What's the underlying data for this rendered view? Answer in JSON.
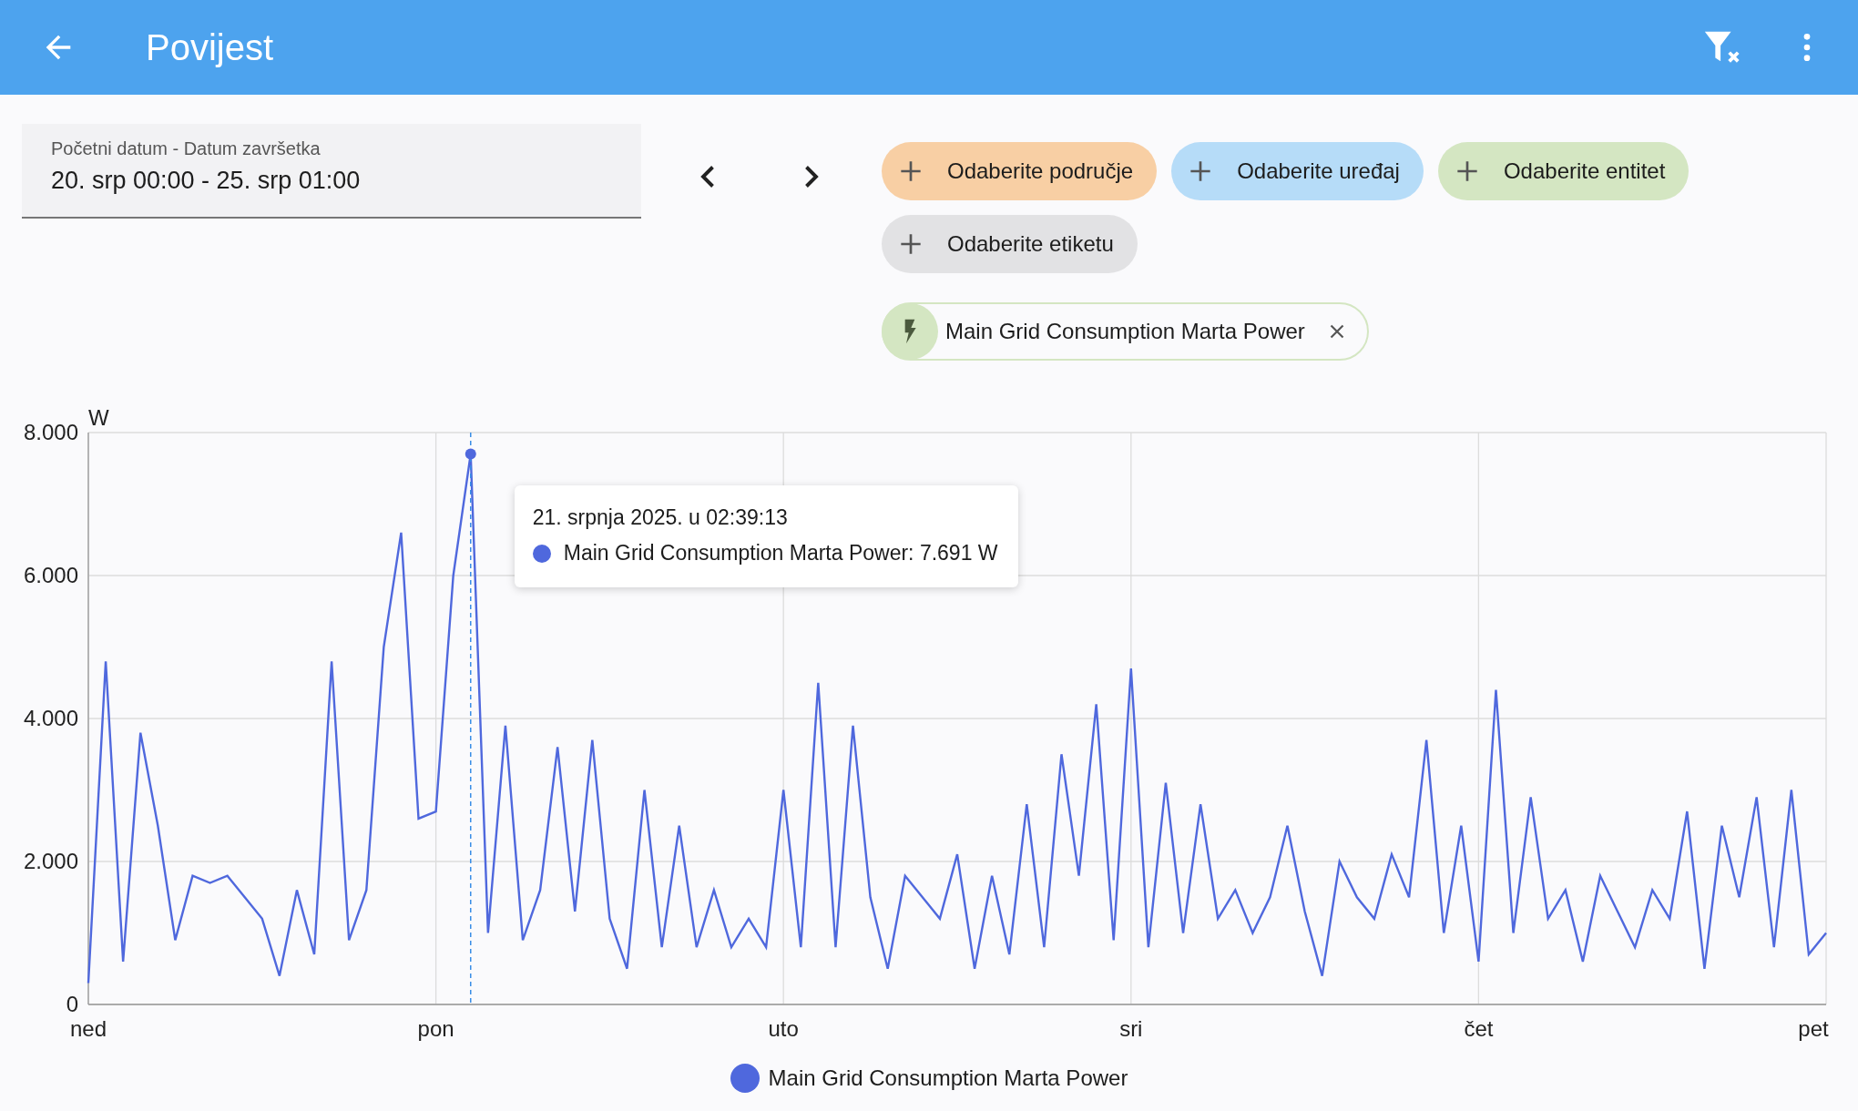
{
  "top_bar": {
    "title": "Povijest"
  },
  "date_range": {
    "label": "Početni datum - Datum završetka",
    "value": "20. srp 00:00 - 25. srp 01:00"
  },
  "target_chips": [
    {
      "label": "Odaberite područje",
      "color": "#f8cfa4"
    },
    {
      "label": "Odaberite uređaj",
      "color": "#b6dcf8"
    },
    {
      "label": "Odaberite entitet",
      "color": "#d4e6c2"
    },
    {
      "label": "Odaberite etiketu",
      "color": "#e2e2e4"
    }
  ],
  "selected_entities": [
    {
      "label": "Main Grid Consumption Marta Power",
      "color": "#d4e6c2"
    }
  ],
  "history": {
    "chart_data": {
      "type": "line",
      "grid": true,
      "ylabel": "W",
      "ylim": [
        0,
        8000
      ],
      "yticks": [
        {
          "value": 0,
          "label": "0"
        },
        {
          "value": 2000,
          "label": "2.000"
        },
        {
          "value": 4000,
          "label": "4.000"
        },
        {
          "value": 6000,
          "label": "6.000"
        },
        {
          "value": 8000,
          "label": "8.000"
        }
      ],
      "categories": [
        "ned",
        null,
        null,
        null,
        null,
        null,
        null,
        null,
        null,
        null,
        null,
        null,
        null,
        null,
        null,
        null,
        null,
        null,
        null,
        null,
        "pon",
        null,
        null,
        null,
        null,
        null,
        null,
        null,
        null,
        null,
        null,
        null,
        null,
        null,
        null,
        null,
        null,
        null,
        null,
        null,
        "uto",
        null,
        null,
        null,
        null,
        null,
        null,
        null,
        null,
        null,
        null,
        null,
        null,
        null,
        null,
        null,
        null,
        null,
        null,
        null,
        "sri",
        null,
        null,
        null,
        null,
        null,
        null,
        null,
        null,
        null,
        null,
        null,
        null,
        null,
        null,
        null,
        null,
        null,
        null,
        null,
        "čet",
        null,
        null,
        null,
        null,
        null,
        null,
        null,
        null,
        null,
        null,
        null,
        null,
        null,
        null,
        null,
        null,
        null,
        null,
        null,
        "pet"
      ],
      "series": [
        {
          "name": "Main Grid Consumption Marta Power",
          "color": "#4f68dd",
          "values": [
            300,
            4800,
            600,
            3800,
            2500,
            900,
            1800,
            1700,
            1800,
            1500,
            1200,
            400,
            1600,
            700,
            4800,
            900,
            1600,
            5000,
            6600,
            2600,
            2700,
            6000,
            7700,
            1000,
            3900,
            900,
            1600,
            3600,
            1300,
            3700,
            1200,
            500,
            3000,
            800,
            2500,
            800,
            1600,
            800,
            1200,
            800,
            3000,
            800,
            4500,
            800,
            3900,
            1500,
            500,
            1800,
            1500,
            1200,
            2100,
            500,
            1800,
            700,
            2800,
            800,
            3500,
            1800,
            4200,
            900,
            4700,
            800,
            3100,
            1000,
            2800,
            1200,
            1600,
            1000,
            1500,
            2500,
            1300,
            400,
            2000,
            1500,
            1200,
            2100,
            1500,
            3700,
            1000,
            2500,
            600,
            4400,
            1000,
            2900,
            1200,
            1600,
            600,
            1800,
            1300,
            800,
            1600,
            1200,
            2700,
            500,
            2500,
            1500,
            2900,
            800,
            3000,
            700,
            1000
          ]
        }
      ]
    }
  },
  "tooltip": {
    "title": "21. srpnja 2025. u 02:39:13",
    "text": "Main Grid Consumption Marta Power: 7.691 W"
  }
}
